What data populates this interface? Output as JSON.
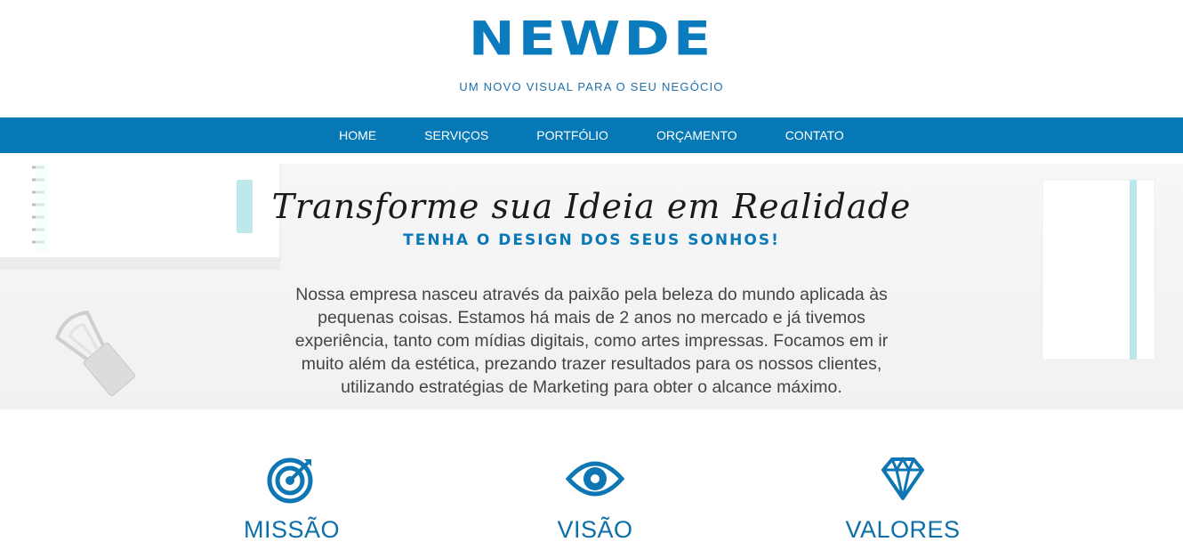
{
  "brand": {
    "logo": "NEWDE",
    "tagline": "UM NOVO VISUAL PARA O SEU NEGÓCIO",
    "color": "#0a7bbd"
  },
  "nav": {
    "items": [
      {
        "label": "HOME"
      },
      {
        "label": "SERVIÇOS"
      },
      {
        "label": "PORTFÓLIO"
      },
      {
        "label": "ORÇAMENTO"
      },
      {
        "label": "CONTATO"
      }
    ],
    "background": "#0678b6"
  },
  "hero": {
    "title": "Transforme sua Ideia em Realidade",
    "subtitle": "TENHA O DESIGN DOS SEUS SONHOS!",
    "body": "Nossa empresa nasceu através da paixão pela beleza do mundo aplicada às pequenas coisas.  Estamos há mais de 2 anos no mercado e já tivemos experiência, tanto com mídias digitais, como artes impressas. Focamos em ir muito além da estética, prezando trazer resultados para os nossos clientes, utilizando estratégias de Marketing para obter o alcance máximo."
  },
  "features": [
    {
      "label": "MISSÃO",
      "icon": "target-icon"
    },
    {
      "label": "VISÃO",
      "icon": "eye-icon"
    },
    {
      "label": "VALORES",
      "icon": "diamond-icon"
    }
  ]
}
